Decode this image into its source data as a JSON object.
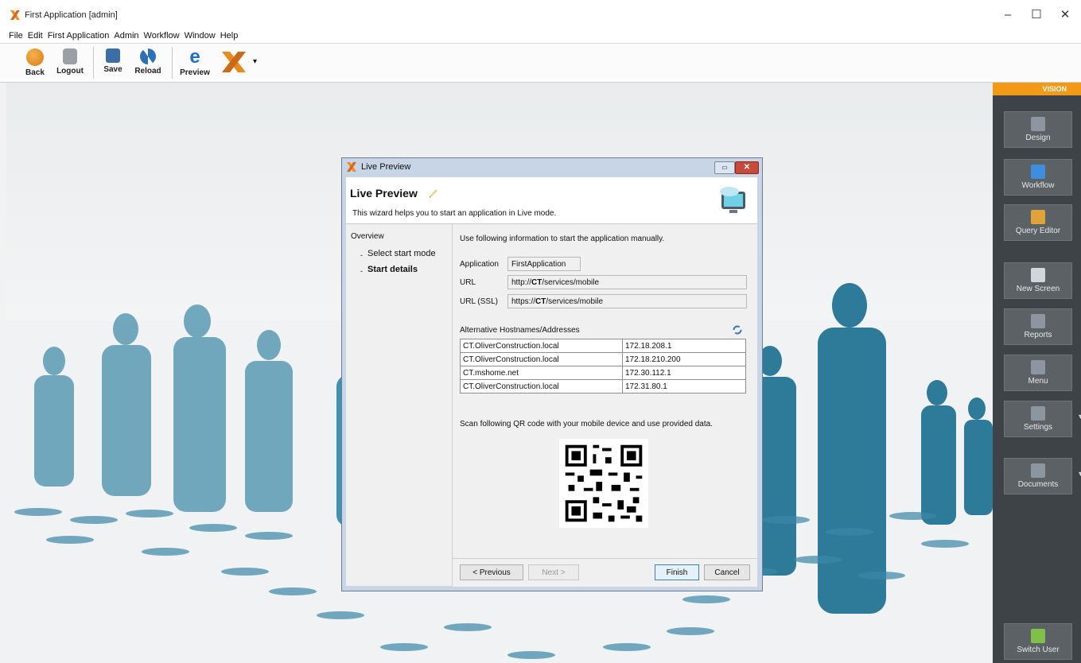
{
  "window": {
    "title": "First Application [admin]",
    "minimize": "–",
    "maximize": "☐",
    "close": "✕"
  },
  "menu": [
    "File",
    "Edit",
    "First Application",
    "Admin",
    "Workflow",
    "Window",
    "Help"
  ],
  "toolbar": {
    "back": "Back",
    "logout": "Logout",
    "save": "Save",
    "reload": "Reload",
    "preview": "Preview",
    "dropdown": "▾"
  },
  "right_panel": {
    "brand": "VISION",
    "buttons": [
      {
        "label": "Design",
        "icon": "design-icon"
      },
      {
        "label": "Workflow",
        "icon": "workflow-icon"
      },
      {
        "label": "Query Editor",
        "icon": "query-editor-icon"
      },
      {
        "label": "New Screen",
        "icon": "new-screen-icon"
      },
      {
        "label": "Reports",
        "icon": "reports-icon"
      },
      {
        "label": "Menu",
        "icon": "menu-icon"
      },
      {
        "label": "Settings",
        "icon": "settings-icon"
      },
      {
        "label": "Documents",
        "icon": "documents-icon"
      },
      {
        "label": "Switch User",
        "icon": "switch-user-icon"
      }
    ],
    "dropdown": "▾"
  },
  "dialog": {
    "window_title": "Live Preview",
    "heading": "Live Preview",
    "subtitle": "This wizard helps you to start an application in Live mode.",
    "nav": {
      "overview": "Overview",
      "items": [
        "Select start mode",
        "Start details"
      ],
      "bullet": "-"
    },
    "intro": "Use following information to start the application manually.",
    "application_label": "Application",
    "application_value": "FirstApplication",
    "url_label": "URL",
    "url_prefix": "http://",
    "url_host": "CT",
    "url_suffix": "/services/mobile",
    "url_ssl_label": "URL (SSL)",
    "url_ssl_prefix": "https://",
    "url_ssl_host": "CT",
    "url_ssl_suffix": "/services/mobile",
    "alt_label": "Alternative Hostnames/Addresses",
    "alt_rows": [
      [
        "CT.OliverConstruction.local",
        "172.18.208.1"
      ],
      [
        "CT.OliverConstruction.local",
        "172.18.210.200"
      ],
      [
        "CT.mshome.net",
        "172.30.112.1"
      ],
      [
        "CT.OliverConstruction.local",
        "172.31.80.1"
      ]
    ],
    "qr_text": "Scan following QR code with your mobile device and use provided data.",
    "buttons": {
      "previous": "< Previous",
      "next": "Next >",
      "finish": "Finish",
      "cancel": "Cancel"
    }
  }
}
